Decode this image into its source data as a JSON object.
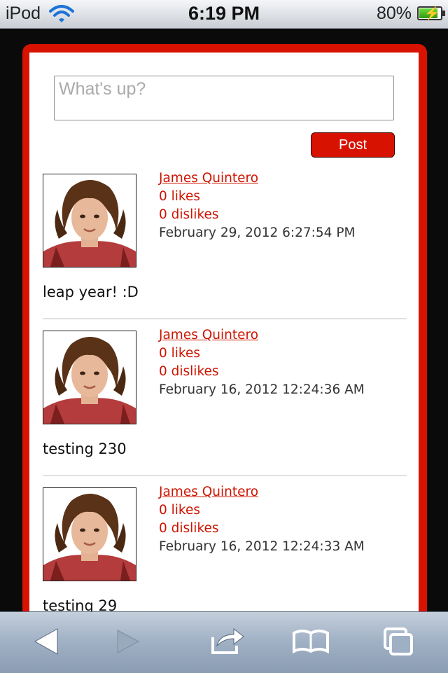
{
  "status_bar": {
    "carrier": "iPod",
    "time": "6:19 PM",
    "battery_percent": "80%",
    "battery_level": 0.8,
    "charging": true
  },
  "compose": {
    "placeholder": "What's up?",
    "post_label": "Post"
  },
  "posts": [
    {
      "author": "James Quintero",
      "likes": "0 likes",
      "dislikes": "0 dislikes",
      "date": "February 29, 2012 6:27:54 PM",
      "text": "leap year! :D"
    },
    {
      "author": "James Quintero",
      "likes": "0 likes",
      "dislikes": "0 dislikes",
      "date": "February 16, 2012 12:24:36 AM",
      "text": "testing 230"
    },
    {
      "author": "James Quintero",
      "likes": "0 likes",
      "dislikes": "0 dislikes",
      "date": "February 16, 2012 12:24:33 AM",
      "text": "testing 29"
    }
  ],
  "toolbar": {
    "icons": [
      "back-arrow-icon",
      "forward-arrow-icon",
      "share-icon",
      "bookmarks-icon",
      "pages-icon"
    ]
  },
  "colors": {
    "accent": "#d81200",
    "link": "#cc1400"
  }
}
